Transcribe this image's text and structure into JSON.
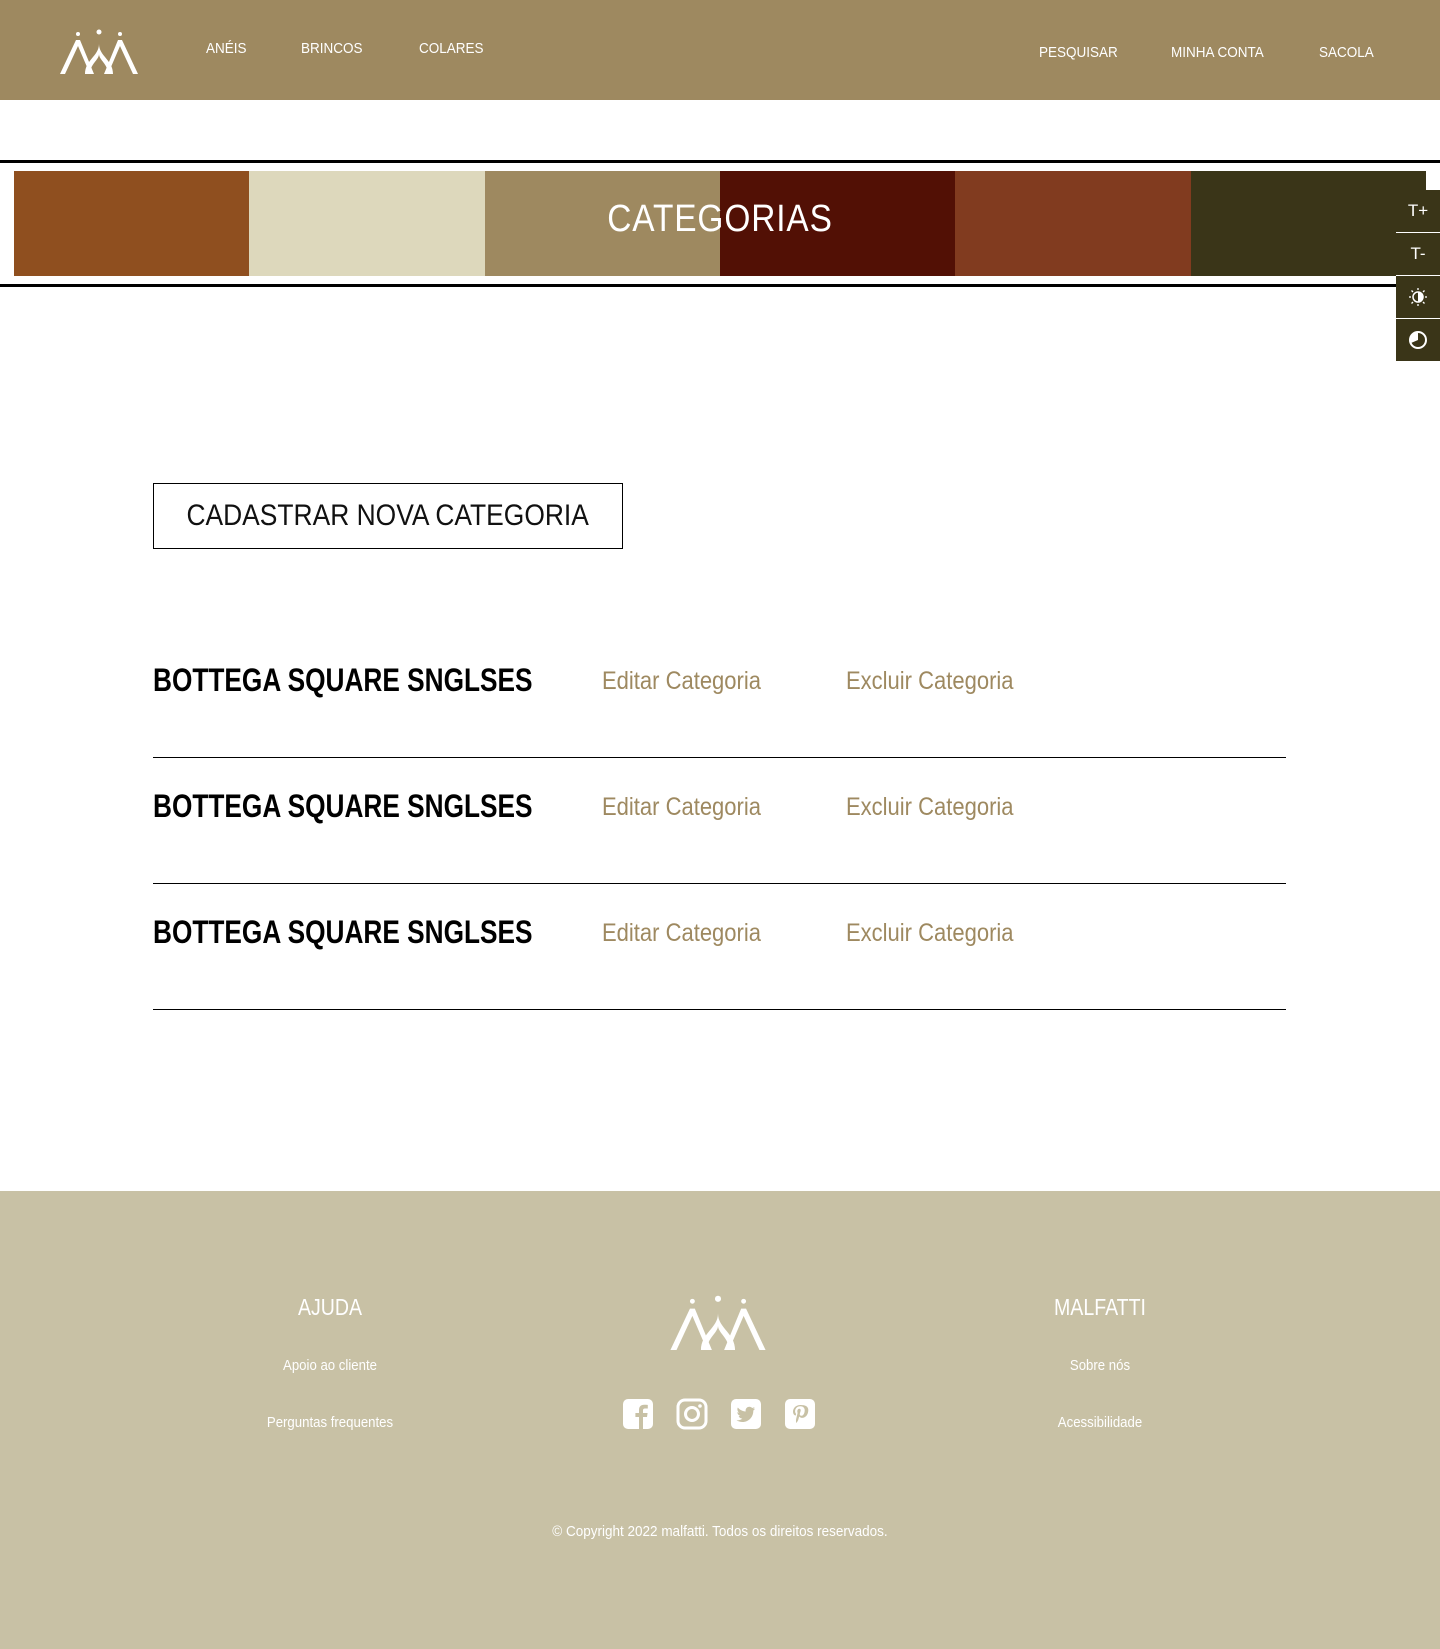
{
  "header": {
    "nav_left": [
      "ANÉIS",
      "BRINCOS",
      "COLARES"
    ],
    "nav_right": [
      "PESQUISAR",
      "MINHA CONTA",
      "SACOLA"
    ],
    "bg_color": "#9e8960"
  },
  "banner": {
    "title": "CATEGORIAS",
    "swatch_colors": [
      "#8f4f1f",
      "#ddd8bc",
      "#9e8960",
      "#521005",
      "#813b1f",
      "#3a3518"
    ]
  },
  "a11y": {
    "increase_text": "T+",
    "decrease_text": "T-",
    "contrast_icon": "contrast-icon",
    "dark_mode_icon": "half-moon-icon"
  },
  "actions": {
    "new_category": "CADASTRAR NOVA CATEGORIA"
  },
  "categories": [
    {
      "name": "BOTTEGA SQUARE SNGLSES",
      "edit": "Editar Categoria",
      "delete": "Excluir Categoria"
    },
    {
      "name": "BOTTEGA SQUARE SNGLSES",
      "edit": "Editar Categoria",
      "delete": "Excluir Categoria"
    },
    {
      "name": "BOTTEGA SQUARE SNGLSES",
      "edit": "Editar Categoria",
      "delete": "Excluir Categoria"
    }
  ],
  "footer": {
    "help_title": "AJUDA",
    "help_links": [
      "Apoio ao cliente",
      "Perguntas frequentes"
    ],
    "brand_title": "MALFATTI",
    "brand_links": [
      "Sobre nós",
      "Acessibilidade"
    ],
    "socials": [
      "facebook-icon",
      "instagram-icon",
      "twitter-icon",
      "pinterest-icon"
    ],
    "copyright": "© Copyright 2022 malfatti. Todos os direitos reservados.",
    "bg_color": "#c8c1a5"
  }
}
